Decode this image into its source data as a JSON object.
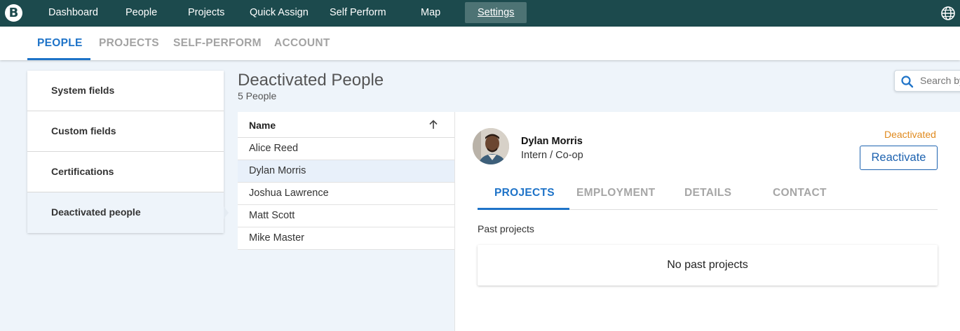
{
  "nav": {
    "logo_letter": "B",
    "items": [
      "Dashboard",
      "People",
      "Projects",
      "Quick Assign",
      "Self Perform",
      "Map",
      "Settings"
    ],
    "active": "Settings",
    "globe_icon": "globe-icon"
  },
  "subtabs": [
    "PEOPLE",
    "PROJECTS",
    "SELF-PERFORM",
    "ACCOUNT"
  ],
  "sidebar": {
    "items": [
      "System fields",
      "Custom fields",
      "Certifications",
      "Deactivated people"
    ],
    "selected": "Deactivated people"
  },
  "page": {
    "title": "Deactivated People",
    "count": "5 People",
    "search_placeholder": "Search by"
  },
  "list": {
    "header": "Name",
    "sort_icon": "arrow-up-icon",
    "rows": [
      "Alice Reed",
      "Dylan Morris",
      "Joshua Lawrence",
      "Matt Scott",
      "Mike Master"
    ],
    "selected": "Dylan Morris"
  },
  "detail": {
    "name": "Dylan Morris",
    "role": "Intern / Co-op",
    "status": "Deactivated",
    "reactivate_label": "Reactivate",
    "tabs": [
      "PROJECTS",
      "EMPLOYMENT",
      "DETAILS",
      "CONTACT"
    ],
    "active_tab": "PROJECTS",
    "past_label": "Past projects",
    "empty_text": "No past projects"
  },
  "colors": {
    "nav_bg": "#1c4a4d",
    "accent": "#1e73c8",
    "status": "#e08a1e"
  }
}
